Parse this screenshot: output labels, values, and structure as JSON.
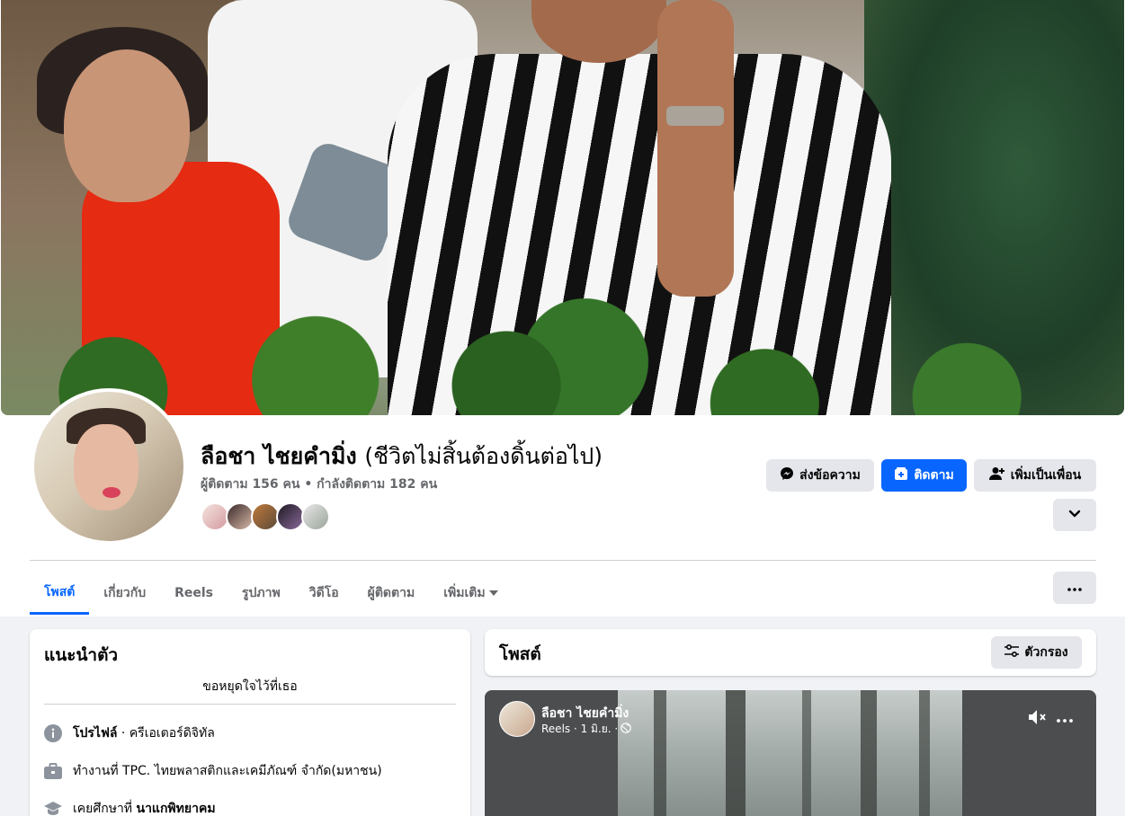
{
  "profile": {
    "name": "ลือชา ไชยคำมิ่ง",
    "alternate_name": "(ชีวิตไม่สิ้นต้องดิ้นต่อไป)",
    "follow_stats": "ผู้ติดตาม 156 คน • กำลังติดตาม 182 คน"
  },
  "actions": {
    "message_label": "ส่งข้อความ",
    "follow_label": "ติดตาม",
    "add_friend_label": "เพิ่มเป็นเพื่อน"
  },
  "tabs": [
    {
      "label": "โพสต์"
    },
    {
      "label": "เกี่ยวกับ"
    },
    {
      "label": "Reels"
    },
    {
      "label": "รูปภาพ"
    },
    {
      "label": "วิดีโอ"
    },
    {
      "label": "ผู้ติดตาม"
    },
    {
      "label": "เพิ่มเติม"
    }
  ],
  "intro": {
    "title": "แนะนำตัว",
    "bio": "ขอหยุดใจไว้ที่เธอ",
    "profile_label": "โปรไฟล์",
    "profile_category": " · ครีเอเตอร์ดิจิทัล",
    "work": "ทำงานที่ TPC. ไทยพลาสติกและเคมีภัณฑ์ จำกัด(มหาชน)",
    "study_prefix": "เคยศึกษาที่ ",
    "study_school": "นาแกพิทยาคม"
  },
  "posts": {
    "title": "โพสต์",
    "filter_label": "ตัวกรอง"
  },
  "reel": {
    "author": "ลือชา ไชยคำมิ่ง",
    "meta": "Reels · 1 มิ.ย. ·"
  },
  "colors": {
    "accent": "#0866ff",
    "secondary_text": "#65676b",
    "button_gray": "#e4e6eb",
    "page_background": "#f0f2f5"
  },
  "icons": [
    "messenger-icon",
    "follow-icon",
    "add-friend-icon",
    "chevron-down-icon",
    "more-icon",
    "info-icon",
    "briefcase-icon",
    "graduation-cap-icon",
    "filter-icon",
    "mute-icon",
    "globe-icon"
  ]
}
